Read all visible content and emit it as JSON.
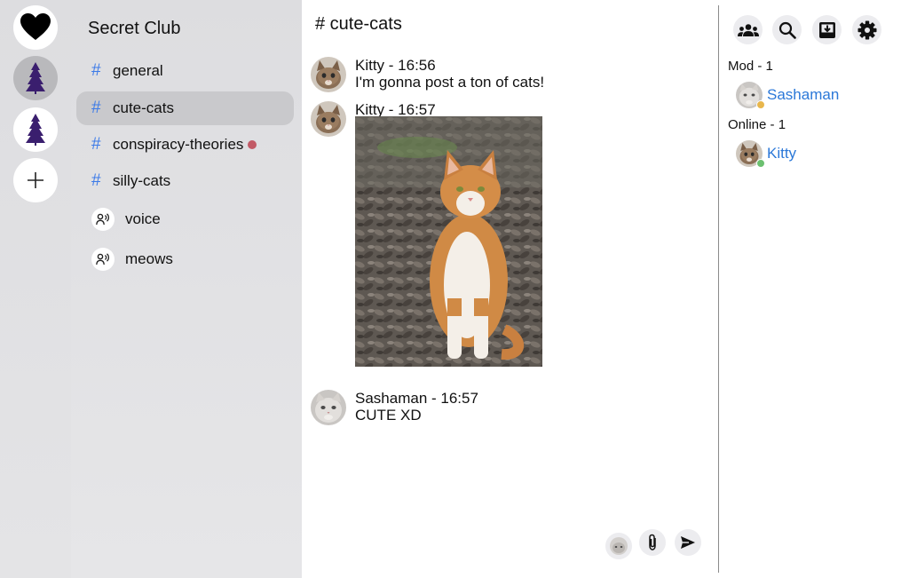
{
  "server_rail": {
    "servers": [
      {
        "name": "heart-server",
        "icon": "heart-icon"
      },
      {
        "name": "tree-server-1",
        "icon": "pine-tree-icon",
        "active": true
      },
      {
        "name": "tree-server-2",
        "icon": "pine-tree-icon"
      }
    ],
    "add_icon": "plus-icon"
  },
  "sidebar": {
    "server_name": "Secret Club",
    "channels": [
      {
        "type": "text",
        "name": "general"
      },
      {
        "type": "text",
        "name": "cute-cats",
        "active": true
      },
      {
        "type": "text",
        "name": "conspiracy-theories",
        "unread": true
      },
      {
        "type": "text",
        "name": "silly-cats"
      },
      {
        "type": "voice",
        "name": "voice"
      },
      {
        "type": "voice",
        "name": "meows"
      }
    ],
    "hash_symbol": "#"
  },
  "chat": {
    "title": "# cute-cats",
    "messages": [
      {
        "author": "Kitty",
        "time": "16:56",
        "header": "Kitty - 16:56",
        "text": "I'm gonna post a ton of cats!"
      },
      {
        "author": "Kitty",
        "time": "16:57",
        "header": "Kitty - 16:57",
        "attachment": "cat-photo"
      },
      {
        "author": "Sashaman",
        "time": "16:57",
        "header": "Sashaman - 16:57",
        "text": "CUTE XD"
      }
    ],
    "composer": {
      "icons": [
        "avatar-icon",
        "paperclip-icon",
        "send-icon"
      ]
    }
  },
  "members": {
    "toolbar_icons": [
      "members-icon",
      "search-icon",
      "inbox-icon",
      "gear-icon"
    ],
    "groups": [
      {
        "label": "Mod - 1",
        "members": [
          {
            "name": "Sashaman",
            "status": "idle",
            "status_color": "#e8b64c"
          }
        ]
      },
      {
        "label": "Online - 1",
        "members": [
          {
            "name": "Kitty",
            "status": "online",
            "status_color": "#6cc070"
          }
        ]
      }
    ]
  },
  "colors": {
    "accent": "#2b78d8",
    "hash": "#3d7be8",
    "unread": "#c25a66",
    "rail_bg": "#dddde0"
  }
}
